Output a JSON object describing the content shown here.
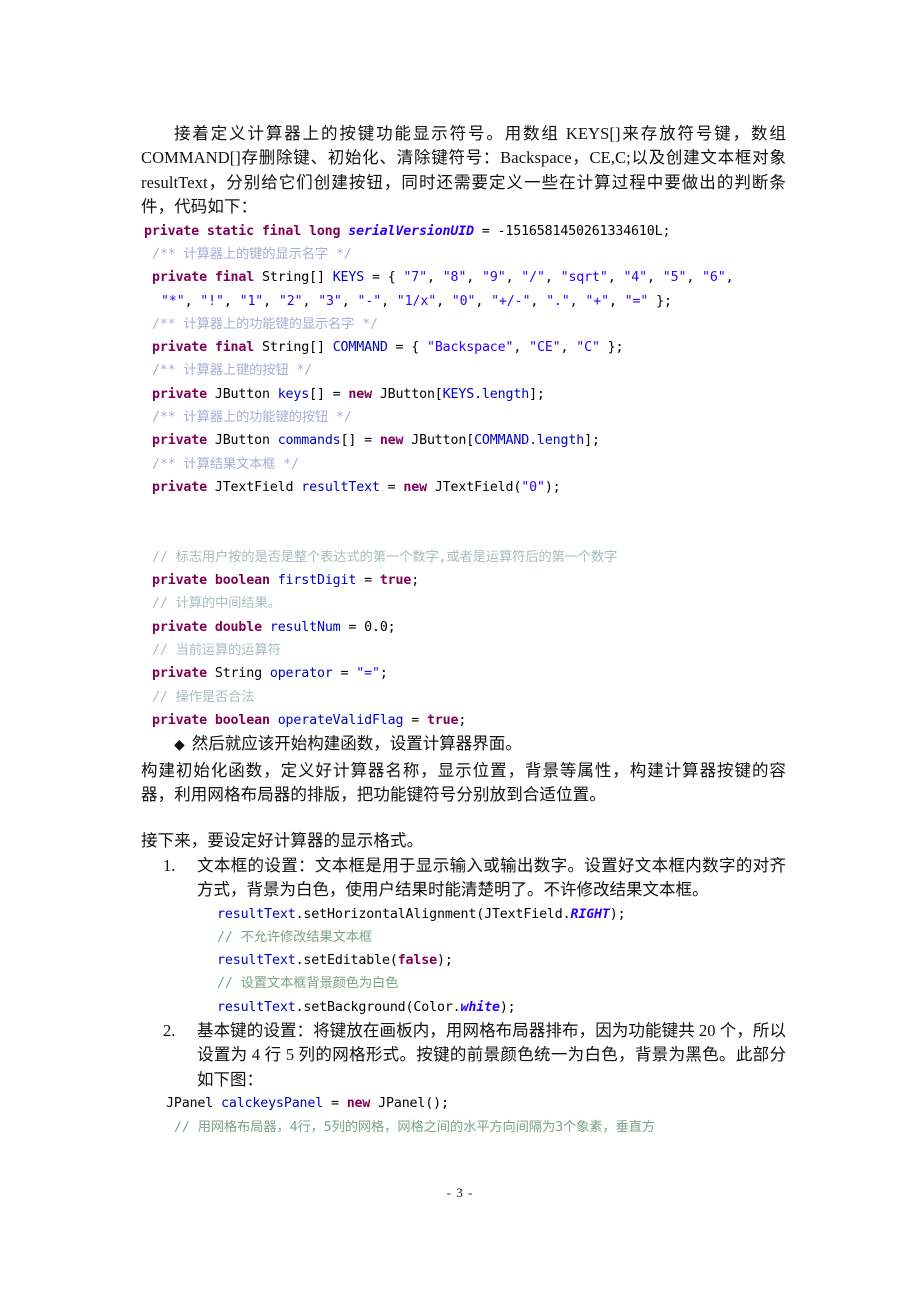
{
  "document": {
    "page_number_label": "- 3 -",
    "paragraphs": {
      "intro": "接着定义计算器上的按键功能显示符号。用数组 KEYS[]来存放符号键，数组 COMMAND[]存删除键、初始化、清除键符号：Backspace，CE,C;以及创建文本框对象 resultText，分别给它们创建按钮，同时还需要定义一些在计算过程中要做出的判断条件，代码如下：",
      "bullet_build": "然后就应该开始构建函数，设置计算器界面。",
      "build_detail": "构建初始化函数，定义好计算器名称，显示位置，背景等属性，构建计算器按键的容器，利用网格布局器的排版，把功能键符号分别放到合适位置。",
      "next_step": "接下来，要设定好计算器的显示格式。"
    },
    "bullet_glyph": "◆",
    "code_block_1": [
      {
        "id": "serial-version",
        "indent": 0,
        "tokens": [
          {
            "t": "private static final long ",
            "c": "kw"
          },
          {
            "t": "serialVersionUID",
            "c": "kw-it"
          },
          {
            "t": " = -1516581450261334610L;",
            "c": "plain"
          }
        ]
      },
      {
        "id": "doc-keys-name",
        "indent": 1,
        "tokens": [
          {
            "t": "/** 计算器上的键的显示名字 */",
            "c": "cmt-doc"
          }
        ]
      },
      {
        "id": "keys-decl-line1",
        "indent": 1,
        "tokens": [
          {
            "t": "private final ",
            "c": "kw"
          },
          {
            "t": "String",
            "c": "plain"
          },
          {
            "t": "[] ",
            "c": "plain"
          },
          {
            "t": "KEYS",
            "c": "id"
          },
          {
            "t": " = { ",
            "c": "plain"
          },
          {
            "t": "\"7\"",
            "c": "str"
          },
          {
            "t": ", ",
            "c": "plain"
          },
          {
            "t": "\"8\"",
            "c": "str"
          },
          {
            "t": ", ",
            "c": "plain"
          },
          {
            "t": "\"9\"",
            "c": "str"
          },
          {
            "t": ", ",
            "c": "plain"
          },
          {
            "t": "\"/\"",
            "c": "str"
          },
          {
            "t": ", ",
            "c": "plain"
          },
          {
            "t": "\"sqrt\"",
            "c": "str"
          },
          {
            "t": ", ",
            "c": "plain"
          },
          {
            "t": "\"4\"",
            "c": "str"
          },
          {
            "t": ", ",
            "c": "plain"
          },
          {
            "t": "\"5\"",
            "c": "str"
          },
          {
            "t": ", ",
            "c": "plain"
          },
          {
            "t": "\"6\"",
            "c": "str"
          },
          {
            "t": ",",
            "c": "plain"
          }
        ]
      },
      {
        "id": "keys-decl-line2",
        "indent": 2,
        "tokens": [
          {
            "t": "\"*\"",
            "c": "str"
          },
          {
            "t": ", ",
            "c": "plain"
          },
          {
            "t": "\"!\"",
            "c": "str"
          },
          {
            "t": ", ",
            "c": "plain"
          },
          {
            "t": "\"1\"",
            "c": "str"
          },
          {
            "t": ", ",
            "c": "plain"
          },
          {
            "t": "\"2\"",
            "c": "str"
          },
          {
            "t": ", ",
            "c": "plain"
          },
          {
            "t": "\"3\"",
            "c": "str"
          },
          {
            "t": ", ",
            "c": "plain"
          },
          {
            "t": "\"-\"",
            "c": "str"
          },
          {
            "t": ", ",
            "c": "plain"
          },
          {
            "t": "\"1/x\"",
            "c": "str"
          },
          {
            "t": ", ",
            "c": "plain"
          },
          {
            "t": "\"0\"",
            "c": "str"
          },
          {
            "t": ", ",
            "c": "plain"
          },
          {
            "t": "\"+/-\"",
            "c": "str"
          },
          {
            "t": ", ",
            "c": "plain"
          },
          {
            "t": "\".\"",
            "c": "str"
          },
          {
            "t": ", ",
            "c": "plain"
          },
          {
            "t": "\"+\"",
            "c": "str"
          },
          {
            "t": ", ",
            "c": "plain"
          },
          {
            "t": "\"=\"",
            "c": "str"
          },
          {
            "t": " };",
            "c": "plain"
          }
        ]
      },
      {
        "id": "doc-command-name",
        "indent": 1,
        "tokens": [
          {
            "t": "/** 计算器上的功能键的显示名字 */",
            "c": "cmt-doc"
          }
        ]
      },
      {
        "id": "command-decl",
        "indent": 1,
        "tokens": [
          {
            "t": "private final ",
            "c": "kw"
          },
          {
            "t": "String[] ",
            "c": "plain"
          },
          {
            "t": "COMMAND",
            "c": "id"
          },
          {
            "t": " = { ",
            "c": "plain"
          },
          {
            "t": "\"Backspace\"",
            "c": "str"
          },
          {
            "t": ", ",
            "c": "plain"
          },
          {
            "t": "\"CE\"",
            "c": "str"
          },
          {
            "t": ", ",
            "c": "plain"
          },
          {
            "t": "\"C\"",
            "c": "str"
          },
          {
            "t": " };",
            "c": "plain"
          }
        ]
      },
      {
        "id": "doc-keys-buttons",
        "indent": 1,
        "tokens": [
          {
            "t": "/** 计算器上键的按钮 */",
            "c": "cmt-doc"
          }
        ]
      },
      {
        "id": "keys-buttons-decl",
        "indent": 1,
        "tokens": [
          {
            "t": "private ",
            "c": "kw"
          },
          {
            "t": "JButton ",
            "c": "plain"
          },
          {
            "t": "keys",
            "c": "id"
          },
          {
            "t": "[] = ",
            "c": "plain"
          },
          {
            "t": "new ",
            "c": "kw"
          },
          {
            "t": "JButton[",
            "c": "plain"
          },
          {
            "t": "KEYS.length",
            "c": "id"
          },
          {
            "t": "];",
            "c": "plain"
          }
        ]
      },
      {
        "id": "doc-command-buttons",
        "indent": 1,
        "tokens": [
          {
            "t": "/** 计算器上的功能键的按钮 */",
            "c": "cmt-doc"
          }
        ]
      },
      {
        "id": "command-buttons-decl",
        "indent": 1,
        "tokens": [
          {
            "t": "private ",
            "c": "kw"
          },
          {
            "t": "JButton ",
            "c": "plain"
          },
          {
            "t": "commands",
            "c": "id"
          },
          {
            "t": "[] = ",
            "c": "plain"
          },
          {
            "t": "new ",
            "c": "kw"
          },
          {
            "t": "JButton[",
            "c": "plain"
          },
          {
            "t": "COMMAND.length",
            "c": "id"
          },
          {
            "t": "];",
            "c": "plain"
          }
        ]
      },
      {
        "id": "doc-result-textfield",
        "indent": 1,
        "tokens": [
          {
            "t": "/** 计算结果文本框 */",
            "c": "cmt-doc"
          }
        ]
      },
      {
        "id": "result-text-decl",
        "indent": 1,
        "tokens": [
          {
            "t": "private ",
            "c": "kw"
          },
          {
            "t": "JTextField ",
            "c": "plain"
          },
          {
            "t": "resultText",
            "c": "id"
          },
          {
            "t": " = ",
            "c": "plain"
          },
          {
            "t": "new ",
            "c": "kw"
          },
          {
            "t": "JTextField(",
            "c": "plain"
          },
          {
            "t": "\"0\"",
            "c": "str"
          },
          {
            "t": ");",
            "c": "plain"
          }
        ]
      },
      {
        "id": "blank-1",
        "indent": 1,
        "tokens": [
          {
            "t": " ",
            "c": "plain"
          }
        ]
      },
      {
        "id": "blank-2",
        "indent": 1,
        "tokens": [
          {
            "t": " ",
            "c": "plain"
          }
        ]
      },
      {
        "id": "cmt-firstdigit",
        "indent": 1,
        "tokens": [
          {
            "t": "// 标志用户按的是否是整个表达式的第一个数字,或者是运算符后的第一个数字",
            "c": "cmt-ln"
          }
        ]
      },
      {
        "id": "firstdigit-decl",
        "indent": 1,
        "tokens": [
          {
            "t": "private boolean ",
            "c": "kw"
          },
          {
            "t": "firstDigit",
            "c": "id"
          },
          {
            "t": " = ",
            "c": "plain"
          },
          {
            "t": "true",
            "c": "kw"
          },
          {
            "t": ";",
            "c": "plain"
          }
        ]
      },
      {
        "id": "cmt-resultnum",
        "indent": 1,
        "tokens": [
          {
            "t": "// 计算的中间结果。",
            "c": "cmt-ln"
          }
        ]
      },
      {
        "id": "resultnum-decl",
        "indent": 1,
        "tokens": [
          {
            "t": "private double ",
            "c": "kw"
          },
          {
            "t": "resultNum",
            "c": "id"
          },
          {
            "t": " = 0.0;",
            "c": "plain"
          }
        ]
      },
      {
        "id": "cmt-operator",
        "indent": 1,
        "tokens": [
          {
            "t": "// 当前运算的运算符",
            "c": "cmt-ln"
          }
        ]
      },
      {
        "id": "operator-decl",
        "indent": 1,
        "tokens": [
          {
            "t": "private ",
            "c": "kw"
          },
          {
            "t": "String ",
            "c": "plain"
          },
          {
            "t": "operator",
            "c": "id"
          },
          {
            "t": " = ",
            "c": "plain"
          },
          {
            "t": "\"=\"",
            "c": "str"
          },
          {
            "t": ";",
            "c": "plain"
          }
        ]
      },
      {
        "id": "cmt-operatevalid",
        "indent": 1,
        "tokens": [
          {
            "t": "// 操作是否合法",
            "c": "cmt-ln"
          }
        ]
      },
      {
        "id": "operatevalid-decl",
        "indent": 1,
        "tokens": [
          {
            "t": "private boolean ",
            "c": "kw"
          },
          {
            "t": "operateValidFlag",
            "c": "id"
          },
          {
            "t": " = ",
            "c": "plain"
          },
          {
            "t": "true",
            "c": "kw"
          },
          {
            "t": ";",
            "c": "plain"
          }
        ]
      }
    ],
    "list_items": [
      {
        "number": "1.",
        "text": "文本框的设置：文本框是用于显示输入或输出数字。设置好文本框内数字的对齐方式，背景为白色，使用户结果时能清楚明了。不许修改结果文本框。",
        "code": [
          {
            "id": "set-horizontal-alignment",
            "tokens": [
              {
                "t": "resultText",
                "c": "id"
              },
              {
                "t": ".setHorizontalAlignment(JTextField.",
                "c": "plain"
              },
              {
                "t": "RIGHT",
                "c": "kw-it"
              },
              {
                "t": ");",
                "c": "plain"
              }
            ]
          },
          {
            "id": "cmt-not-editable",
            "tokens": [
              {
                "t": "// 不允许修改结果文本框",
                "c": "cmt-grn"
              }
            ]
          },
          {
            "id": "set-editable-false",
            "tokens": [
              {
                "t": "resultText",
                "c": "id"
              },
              {
                "t": ".setEditable(",
                "c": "plain"
              },
              {
                "t": "false",
                "c": "kw"
              },
              {
                "t": ");",
                "c": "plain"
              }
            ]
          },
          {
            "id": "cmt-set-background-white",
            "tokens": [
              {
                "t": "// 设置文本框背景颜色为白色",
                "c": "cmt-grn"
              }
            ]
          },
          {
            "id": "set-background-white",
            "tokens": [
              {
                "t": "resultText",
                "c": "id"
              },
              {
                "t": ".setBackground(Color.",
                "c": "plain"
              },
              {
                "t": "white",
                "c": "kw-it"
              },
              {
                "t": ");",
                "c": "plain"
              }
            ]
          }
        ]
      },
      {
        "number": "2.",
        "text": "基本键的设置：将键放在画板内，用网格布局器排布，因为功能键共 20 个，所以设置为 4 行 5 列的网格形式。按键的前景颜色统一为白色，背景为黑色。此部分如下图：",
        "code": [
          {
            "id": "calckeys-panel-decl",
            "indent": 0,
            "tokens": [
              {
                "t": "JPanel ",
                "c": "plain"
              },
              {
                "t": "calckeysPanel",
                "c": "id"
              },
              {
                "t": " = ",
                "c": "plain"
              },
              {
                "t": "new ",
                "c": "kw"
              },
              {
                "t": "JPanel();",
                "c": "plain"
              }
            ]
          },
          {
            "id": "cmt-grid-layout",
            "indent": 1,
            "tokens": [
              {
                "t": "// 用网格布局器，4行，5列的网格，网格之间的水平方向间隔为3个象素，垂直方",
                "c": "cmt-grn"
              }
            ]
          }
        ]
      }
    ]
  }
}
